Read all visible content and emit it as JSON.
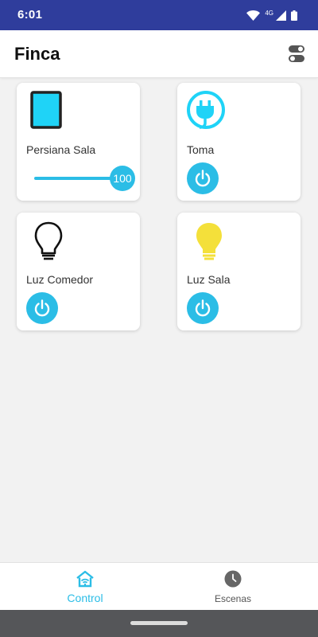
{
  "status_bar": {
    "time": "6:01",
    "network": "4G",
    "icons": [
      "wifi-icon",
      "signal-icon",
      "battery-icon"
    ]
  },
  "app_bar": {
    "title": "Finca",
    "action_icon": "toggle-switches-icon"
  },
  "devices": [
    {
      "label": "Persiana Sala",
      "icon": "blind-icon",
      "control": "slider",
      "value": "100"
    },
    {
      "label": "Toma",
      "icon": "plug-icon",
      "control": "power"
    },
    {
      "label": "Luz Comedor",
      "icon": "bulb-off-icon",
      "control": "power"
    },
    {
      "label": "Luz Sala",
      "icon": "bulb-on-icon",
      "control": "power"
    }
  ],
  "bottom_nav": {
    "items": [
      {
        "label": "Control",
        "icon": "home-wifi-icon",
        "active": true
      },
      {
        "label": "Escenas",
        "icon": "clock-icon",
        "active": false
      }
    ]
  },
  "colors": {
    "status_bar": "#2f3d9c",
    "accent": "#2bbde6",
    "bulb_on": "#f4e03a",
    "blind_fill": "#1fd3f7",
    "system_nav": "#555659"
  }
}
